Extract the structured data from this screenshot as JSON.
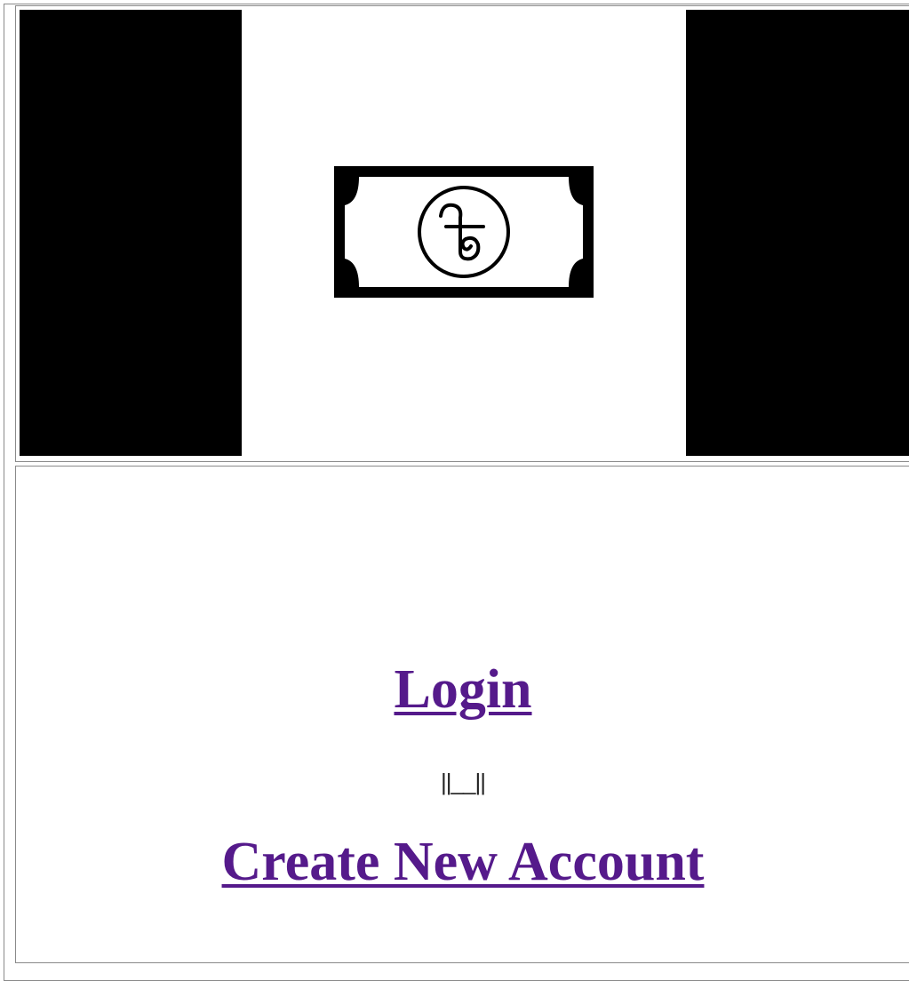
{
  "banner": {
    "icon": "banknote-icon",
    "background_color": "#000000",
    "panel_color": "#ffffff"
  },
  "links": {
    "login_label": "Login",
    "separator_text": "||__||",
    "create_account_label": "Create New Account",
    "link_color": "#551a8b"
  }
}
